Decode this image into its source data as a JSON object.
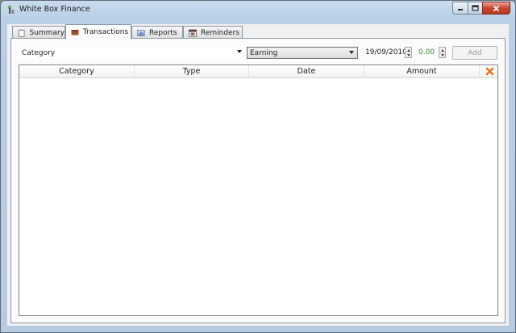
{
  "window": {
    "title": "White Box Finance",
    "controls": {
      "minimize": "minimize-icon",
      "maximize": "maximize-icon",
      "close": "close-icon"
    }
  },
  "tabs": [
    {
      "label": "Summary",
      "icon": "clipboard-icon",
      "active": false
    },
    {
      "label": "Transactions",
      "icon": "wallet-icon",
      "active": true
    },
    {
      "label": "Reports",
      "icon": "chart-icon",
      "active": false
    },
    {
      "label": "Reminders",
      "icon": "calendar-icon",
      "active": false
    }
  ],
  "form": {
    "category_value": "Category",
    "type_value": "Earning",
    "date_value": "19/09/2010",
    "amount_value": "0.00",
    "add_label": "Add"
  },
  "table": {
    "columns": [
      "Category",
      "Type",
      "Date",
      "Amount"
    ],
    "rows": []
  },
  "colors": {
    "window_frame": "#b9cfe6",
    "close_button": "#c9462c",
    "amount_text": "#3a8a3a",
    "delete_icon": "#e87722"
  }
}
